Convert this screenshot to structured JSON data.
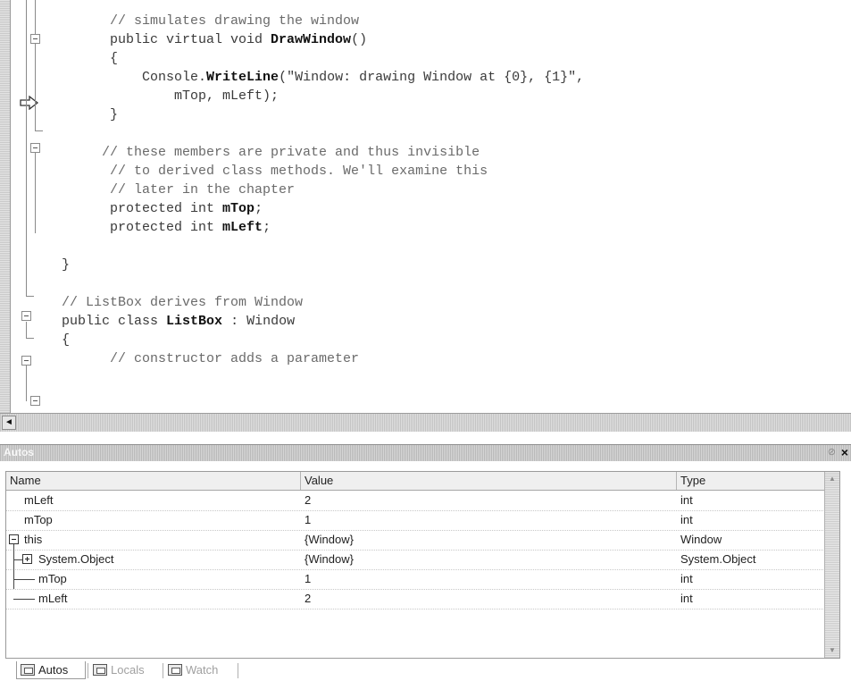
{
  "editor": {
    "lines": [
      {
        "indent": "        ",
        "comment": "// simulates drawing the window"
      },
      {
        "indent": "        ",
        "plain": "public virtual void ",
        "bold": "DrawWindow",
        "tail": "()"
      },
      {
        "indent": "        ",
        "plain": "{"
      },
      {
        "indent": "            ",
        "plain": "Console.",
        "bold": "WriteLine",
        "tail": "(\"Window: drawing Window at {0}, {1}\","
      },
      {
        "indent": "                ",
        "plain": "mTop, mLeft);"
      },
      {
        "indent": "        ",
        "plain": "}"
      },
      {
        "indent": "",
        "plain": ""
      },
      {
        "indent": "       ",
        "comment": "// these members are private and thus invisible"
      },
      {
        "indent": "        ",
        "comment": "// to derived class methods. We'll examine this"
      },
      {
        "indent": "        ",
        "comment": "// later in the chapter"
      },
      {
        "indent": "        ",
        "plain": "protected int ",
        "bold": "mTop",
        "tail": ";"
      },
      {
        "indent": "        ",
        "plain": "protected int ",
        "bold": "mLeft",
        "tail": ";"
      },
      {
        "indent": "",
        "plain": ""
      },
      {
        "indent": "  ",
        "plain": "}"
      },
      {
        "indent": "",
        "plain": ""
      },
      {
        "indent": "  ",
        "comment": "// ListBox derives from Window"
      },
      {
        "indent": "  ",
        "plain": "public class ",
        "bold": "ListBox",
        "tail": " : Window"
      },
      {
        "indent": "  ",
        "plain": "{"
      },
      {
        "indent": "        ",
        "comment": "// constructor adds a parameter"
      }
    ],
    "current_line_arrow": "arrow-right-icon"
  },
  "autos": {
    "title": "Autos",
    "pin_icon": "pin-icon",
    "close_label": "×",
    "columns": {
      "name": "Name",
      "value": "Value",
      "type": "Type"
    },
    "rows": [
      {
        "name": "mLeft",
        "value": "2",
        "type": "int"
      },
      {
        "name": "mTop",
        "value": "1",
        "type": "int"
      },
      {
        "name": "this",
        "value": "{Window}",
        "type": "Window"
      },
      {
        "name": "System.Object",
        "value": "{Window}",
        "type": "System.Object"
      },
      {
        "name": "mTop",
        "value": "1",
        "type": "int"
      },
      {
        "name": "mLeft",
        "value": "2",
        "type": "int"
      }
    ]
  },
  "tabs": [
    {
      "label": "Autos",
      "icon": "autos-window-icon",
      "active": true
    },
    {
      "label": "Locals",
      "icon": "locals-window-icon",
      "active": false
    },
    {
      "label": "Watch",
      "icon": "watch-window-icon",
      "active": false
    }
  ],
  "scroll": {
    "left_arrow": "◄",
    "up_arrow": "▲",
    "down_arrow": "▼"
  }
}
